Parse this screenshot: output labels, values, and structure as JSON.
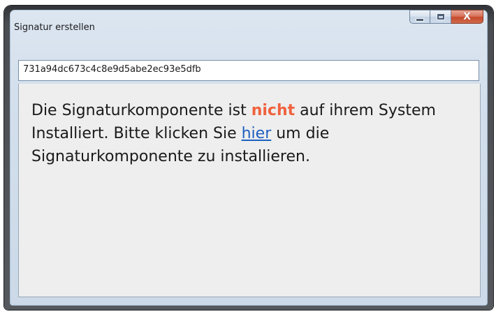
{
  "window": {
    "title": "Signatur erstellen",
    "buttons": {
      "minimize_icon": "minimize-icon",
      "maximize_icon": "maximize-icon",
      "close_icon": "close-icon",
      "close_glyph": "X"
    }
  },
  "field": {
    "value": "731a94dc673c4c8e9d5abe2ec93e5dfb"
  },
  "message": {
    "part1": "Die Signaturkomponente ist ",
    "emphasis": "nicht",
    "part2": " auf ihrem System Installiert. Bitte klicken Sie ",
    "link": "hier",
    "part3": " um die Signaturkomponente zu installieren."
  },
  "colors": {
    "emphasis": "#f0623f",
    "link": "#1d5fbf",
    "close_button": "#c64a2c"
  }
}
